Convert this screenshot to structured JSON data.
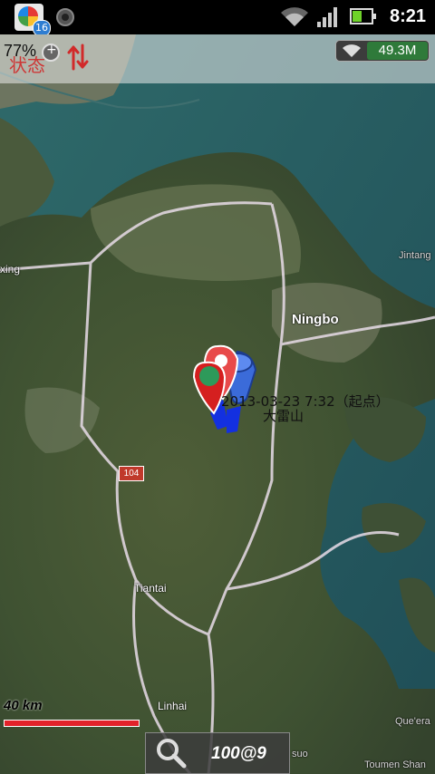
{
  "status_bar": {
    "notification_count": "16",
    "time": "8:21",
    "battery_level": 0.45
  },
  "top_bar": {
    "battery_percent": "77%",
    "status_label": "状态",
    "network_speed": "49.3M"
  },
  "map": {
    "places": {
      "ningbo": "Ningbo",
      "tiantai": "Tiantai",
      "linhai": "Linhai",
      "xing": "xing",
      "jintang": "Jintang",
      "quera": "Que'era",
      "toumen": "Toumen Shan",
      "suo": "suo"
    },
    "road_shield": "104",
    "marker_label": "2013-03-23 7:32（起点）",
    "marker_sublabel": "大雷山",
    "scale_text": "40 km",
    "search_text": "100@9"
  },
  "colors": {
    "scale_bar": "#e2222a",
    "status_label": "#d12a2a",
    "network_badge": "#2f7a3a"
  }
}
